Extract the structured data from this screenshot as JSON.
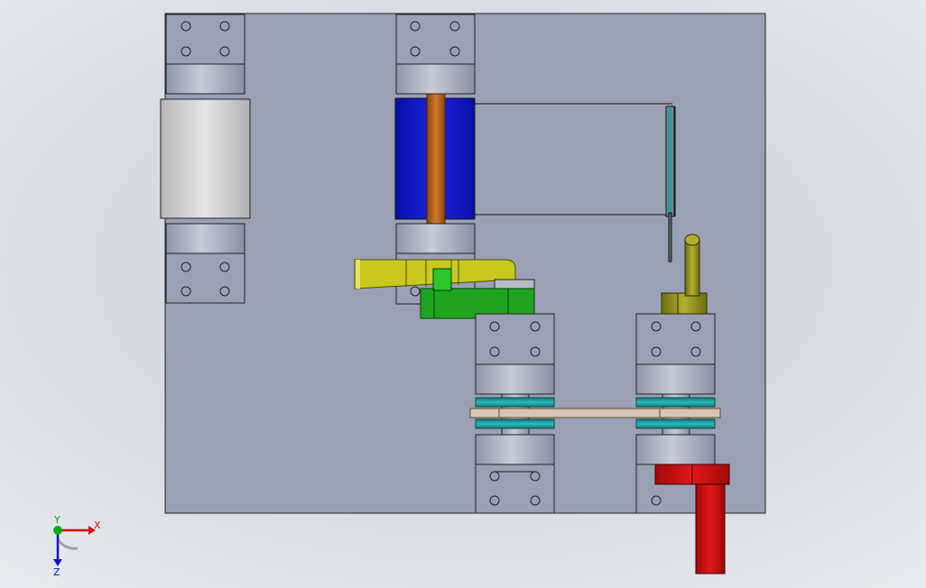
{
  "viewport": {
    "background_center": "#c9ced6",
    "background_edge": "#e6e9ed",
    "plate_color": "#9aa1b4"
  },
  "parts": {
    "roller_left": {
      "color": "#d4d4d4"
    },
    "roller_blue": {
      "color": "#0a12c8"
    },
    "shaft": {
      "color": "#b0601a"
    },
    "yellow_arm": {
      "color": "#c8c81e"
    },
    "green_block": {
      "color": "#1fa41f"
    },
    "belt": {
      "color": "#d8c6b4"
    },
    "pulleys": {
      "color": "#1fa0a0"
    },
    "olive_pin": {
      "color": "#8a8a18"
    },
    "red_handle": {
      "color": "#c80a0a"
    }
  },
  "triad": {
    "x_label": "X",
    "y_label": "Y",
    "z_label": "Z",
    "x_color": "#cc1111",
    "y_color": "#11aa11",
    "z_color": "#1111cc"
  }
}
